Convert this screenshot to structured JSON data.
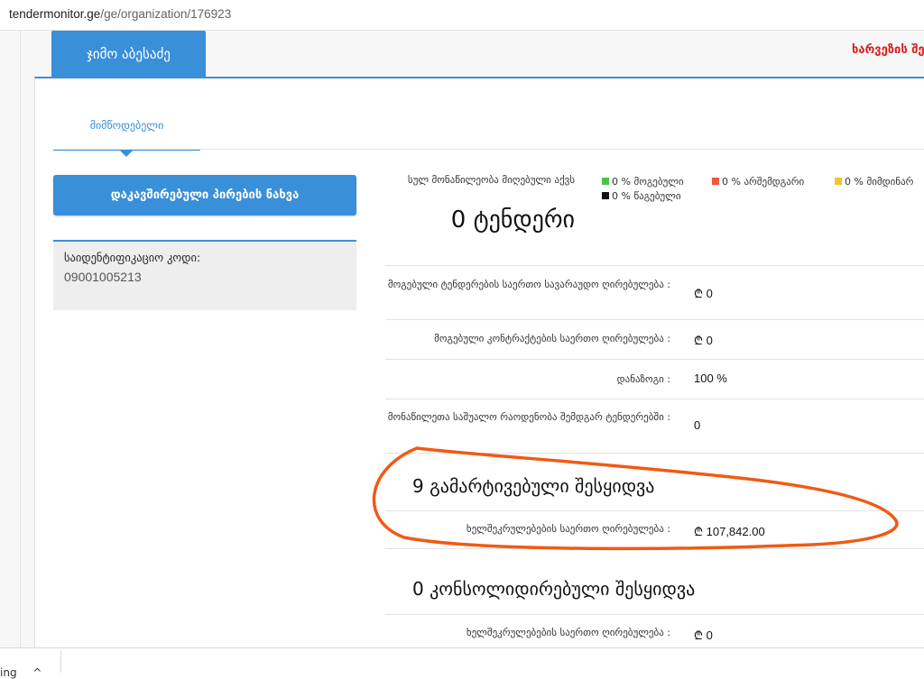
{
  "browser": {
    "url_host": "tendermonitor.ge",
    "url_path": "/ge/organization/176923"
  },
  "header": {
    "org_name": "ჯიმო აბესაძე",
    "top_right_link": "ხარვეზის შე"
  },
  "tabs": {
    "supplier": "მიმწოდებელი"
  },
  "sidebar": {
    "related_button": "დაკავშირებული პირების ნახვა",
    "id_label": "საიდენტიფიკაციო კოდი:",
    "id_value": "09001005213"
  },
  "stats": {
    "total_label": "სულ მონაწილეობა მიღებული აქვს",
    "total_value": "0 ტენდერი",
    "legend": [
      {
        "label": "0 % მოგებული",
        "color": "#4cc44c"
      },
      {
        "label": "0 % არშემდგარი",
        "color": "#f0573c"
      },
      {
        "label": "0 % მიმდინარ",
        "color": "#f5c32c"
      },
      {
        "label": "0 % წაგებული",
        "color": "#111111"
      }
    ],
    "rows": [
      {
        "label": "მოგებული ტენდერების საერთო სავარაუდო ღირებულება :",
        "value": "₾ 0"
      },
      {
        "label": "მოგებული კონტრაქტების საერთო ღირებულება :",
        "value": "₾ 0"
      },
      {
        "label": "დანაზოგი :",
        "value": "100 %"
      },
      {
        "label": "მონაწილეთა საშუალო რაოდენობა შემდგარ ტენდერებში :",
        "value": "0"
      }
    ]
  },
  "simplified": {
    "title": "9 გამარტივებული შესყიდვა",
    "row_label": "ხელშეკრულებების საერთო ღირებულება :",
    "row_value": "₾ 107,842.00"
  },
  "consolidated": {
    "title": "0 კონსოლიდირებული შესყიდვა",
    "row_label": "ხელშეკრულებების საერთო ღირებულება :",
    "row_value": "₾ 0"
  },
  "bottom": {
    "fragment": "ing",
    "fragment2": "^"
  },
  "colors": {
    "accent": "#3a8fd9",
    "annotation": "#f05a14",
    "link_red": "#d81f1f"
  }
}
